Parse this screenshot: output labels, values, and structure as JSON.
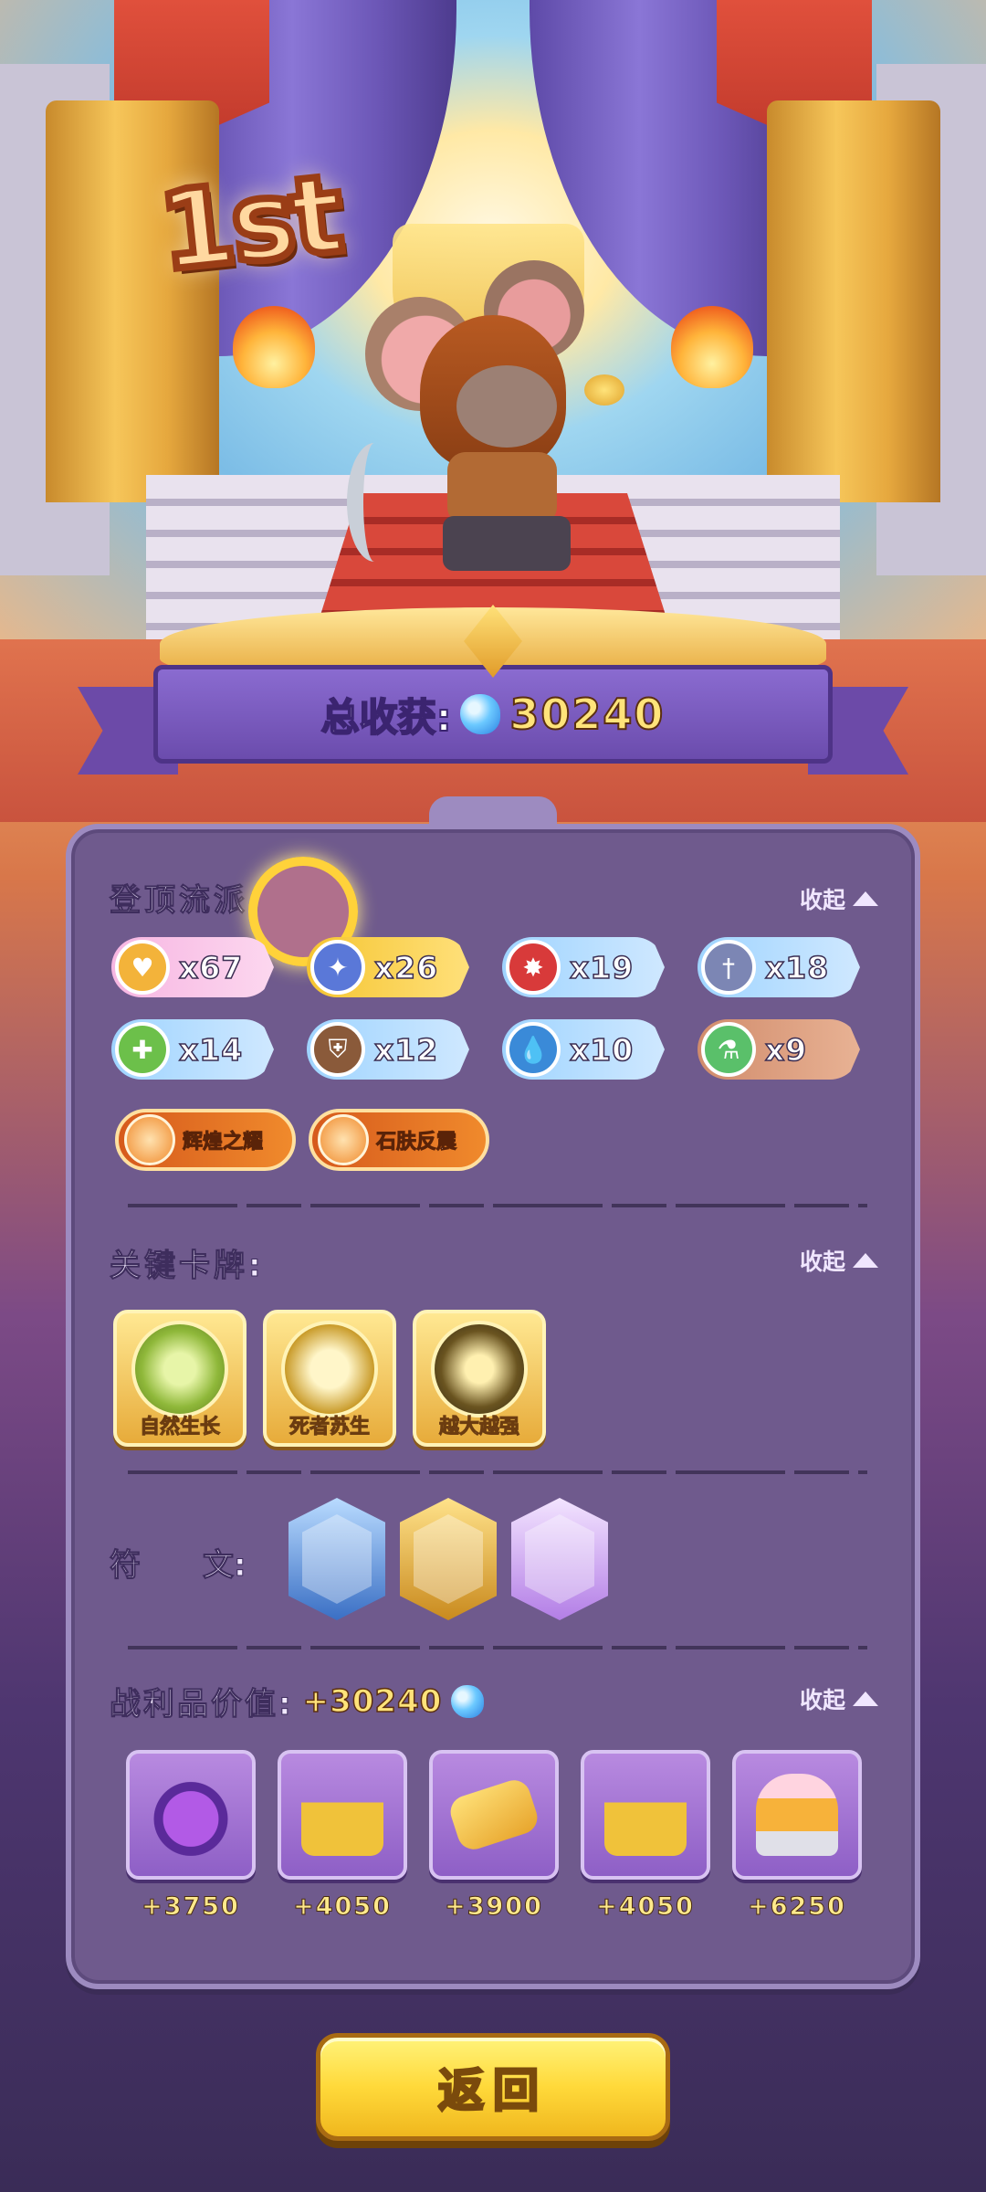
{
  "header": {
    "rank": "1st",
    "total_label": "总收获:",
    "total_value": "30240"
  },
  "build": {
    "title": "登顶流派:",
    "collapse_label": "收起",
    "tags": [
      {
        "count": "x67",
        "icon": "heart-icon",
        "color": "#f7b6e2"
      },
      {
        "count": "x26",
        "icon": "sword-burst-icon",
        "color": "#f5c531"
      },
      {
        "count": "x19",
        "icon": "crit-splash-icon",
        "color": "#9fd4ff"
      },
      {
        "count": "x18",
        "icon": "dagger-icon",
        "color": "#9fd4ff"
      },
      {
        "count": "x14",
        "icon": "heal-cross-icon",
        "color": "#9fd4ff"
      },
      {
        "count": "x12",
        "icon": "shield-icon",
        "color": "#9fd4ff"
      },
      {
        "count": "x10",
        "icon": "water-drop-icon",
        "color": "#9fd4ff"
      },
      {
        "count": "x9",
        "icon": "potion-icon",
        "color": "#d18c6c"
      }
    ],
    "specials": [
      {
        "label": "辉煌之耀"
      },
      {
        "label": "石肤反震"
      }
    ]
  },
  "cards": {
    "title": "关键卡牌:",
    "collapse_label": "收起",
    "items": [
      {
        "name": "自然生长"
      },
      {
        "name": "死者苏生"
      },
      {
        "name": "越大越强"
      }
    ]
  },
  "runes": {
    "title": "符　　文:",
    "items": [
      {
        "icon": "balance-scale-icon",
        "color": "#3a6fc4"
      },
      {
        "icon": "heart-altar-icon",
        "color": "#c98a1e"
      },
      {
        "icon": "spirit-doll-icon",
        "color": "#b37ee6"
      }
    ]
  },
  "loot": {
    "title": "战利品价值:",
    "value": "+30240",
    "collapse_label": "收起",
    "items": [
      {
        "icon": "demon-candy-icon",
        "value": "+3750"
      },
      {
        "icon": "padlock-chain-icon",
        "value": "+4050"
      },
      {
        "icon": "vip-ticket-icon",
        "value": "+3900"
      },
      {
        "icon": "padlock-chain-icon",
        "value": "+4050"
      },
      {
        "icon": "cake-icon",
        "value": "+6250"
      }
    ]
  },
  "return_button": {
    "label": "返回"
  }
}
